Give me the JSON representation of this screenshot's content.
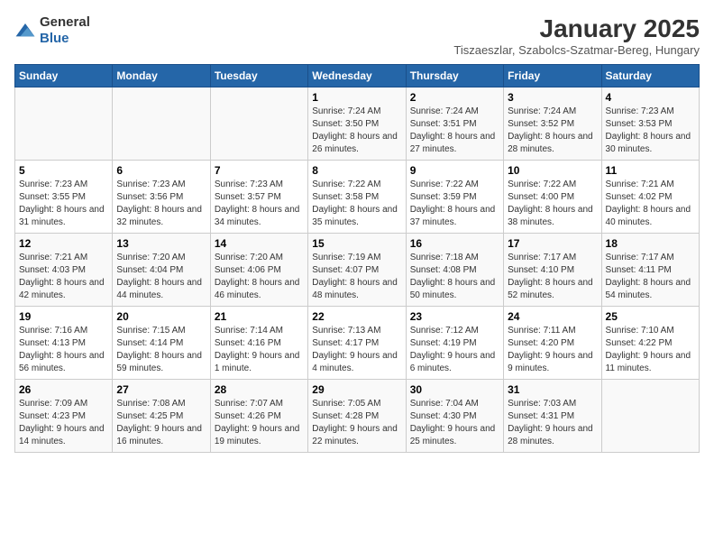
{
  "logo": {
    "text_general": "General",
    "text_blue": "Blue"
  },
  "title": "January 2025",
  "subtitle": "Tiszaeszlar, Szabolcs-Szatmar-Bereg, Hungary",
  "weekdays": [
    "Sunday",
    "Monday",
    "Tuesday",
    "Wednesday",
    "Thursday",
    "Friday",
    "Saturday"
  ],
  "weeks": [
    [
      {
        "day": "",
        "info": ""
      },
      {
        "day": "",
        "info": ""
      },
      {
        "day": "",
        "info": ""
      },
      {
        "day": "1",
        "info": "Sunrise: 7:24 AM\nSunset: 3:50 PM\nDaylight: 8 hours and 26 minutes."
      },
      {
        "day": "2",
        "info": "Sunrise: 7:24 AM\nSunset: 3:51 PM\nDaylight: 8 hours and 27 minutes."
      },
      {
        "day": "3",
        "info": "Sunrise: 7:24 AM\nSunset: 3:52 PM\nDaylight: 8 hours and 28 minutes."
      },
      {
        "day": "4",
        "info": "Sunrise: 7:23 AM\nSunset: 3:53 PM\nDaylight: 8 hours and 30 minutes."
      }
    ],
    [
      {
        "day": "5",
        "info": "Sunrise: 7:23 AM\nSunset: 3:55 PM\nDaylight: 8 hours and 31 minutes."
      },
      {
        "day": "6",
        "info": "Sunrise: 7:23 AM\nSunset: 3:56 PM\nDaylight: 8 hours and 32 minutes."
      },
      {
        "day": "7",
        "info": "Sunrise: 7:23 AM\nSunset: 3:57 PM\nDaylight: 8 hours and 34 minutes."
      },
      {
        "day": "8",
        "info": "Sunrise: 7:22 AM\nSunset: 3:58 PM\nDaylight: 8 hours and 35 minutes."
      },
      {
        "day": "9",
        "info": "Sunrise: 7:22 AM\nSunset: 3:59 PM\nDaylight: 8 hours and 37 minutes."
      },
      {
        "day": "10",
        "info": "Sunrise: 7:22 AM\nSunset: 4:00 PM\nDaylight: 8 hours and 38 minutes."
      },
      {
        "day": "11",
        "info": "Sunrise: 7:21 AM\nSunset: 4:02 PM\nDaylight: 8 hours and 40 minutes."
      }
    ],
    [
      {
        "day": "12",
        "info": "Sunrise: 7:21 AM\nSunset: 4:03 PM\nDaylight: 8 hours and 42 minutes."
      },
      {
        "day": "13",
        "info": "Sunrise: 7:20 AM\nSunset: 4:04 PM\nDaylight: 8 hours and 44 minutes."
      },
      {
        "day": "14",
        "info": "Sunrise: 7:20 AM\nSunset: 4:06 PM\nDaylight: 8 hours and 46 minutes."
      },
      {
        "day": "15",
        "info": "Sunrise: 7:19 AM\nSunset: 4:07 PM\nDaylight: 8 hours and 48 minutes."
      },
      {
        "day": "16",
        "info": "Sunrise: 7:18 AM\nSunset: 4:08 PM\nDaylight: 8 hours and 50 minutes."
      },
      {
        "day": "17",
        "info": "Sunrise: 7:17 AM\nSunset: 4:10 PM\nDaylight: 8 hours and 52 minutes."
      },
      {
        "day": "18",
        "info": "Sunrise: 7:17 AM\nSunset: 4:11 PM\nDaylight: 8 hours and 54 minutes."
      }
    ],
    [
      {
        "day": "19",
        "info": "Sunrise: 7:16 AM\nSunset: 4:13 PM\nDaylight: 8 hours and 56 minutes."
      },
      {
        "day": "20",
        "info": "Sunrise: 7:15 AM\nSunset: 4:14 PM\nDaylight: 8 hours and 59 minutes."
      },
      {
        "day": "21",
        "info": "Sunrise: 7:14 AM\nSunset: 4:16 PM\nDaylight: 9 hours and 1 minute."
      },
      {
        "day": "22",
        "info": "Sunrise: 7:13 AM\nSunset: 4:17 PM\nDaylight: 9 hours and 4 minutes."
      },
      {
        "day": "23",
        "info": "Sunrise: 7:12 AM\nSunset: 4:19 PM\nDaylight: 9 hours and 6 minutes."
      },
      {
        "day": "24",
        "info": "Sunrise: 7:11 AM\nSunset: 4:20 PM\nDaylight: 9 hours and 9 minutes."
      },
      {
        "day": "25",
        "info": "Sunrise: 7:10 AM\nSunset: 4:22 PM\nDaylight: 9 hours and 11 minutes."
      }
    ],
    [
      {
        "day": "26",
        "info": "Sunrise: 7:09 AM\nSunset: 4:23 PM\nDaylight: 9 hours and 14 minutes."
      },
      {
        "day": "27",
        "info": "Sunrise: 7:08 AM\nSunset: 4:25 PM\nDaylight: 9 hours and 16 minutes."
      },
      {
        "day": "28",
        "info": "Sunrise: 7:07 AM\nSunset: 4:26 PM\nDaylight: 9 hours and 19 minutes."
      },
      {
        "day": "29",
        "info": "Sunrise: 7:05 AM\nSunset: 4:28 PM\nDaylight: 9 hours and 22 minutes."
      },
      {
        "day": "30",
        "info": "Sunrise: 7:04 AM\nSunset: 4:30 PM\nDaylight: 9 hours and 25 minutes."
      },
      {
        "day": "31",
        "info": "Sunrise: 7:03 AM\nSunset: 4:31 PM\nDaylight: 9 hours and 28 minutes."
      },
      {
        "day": "",
        "info": ""
      }
    ]
  ]
}
